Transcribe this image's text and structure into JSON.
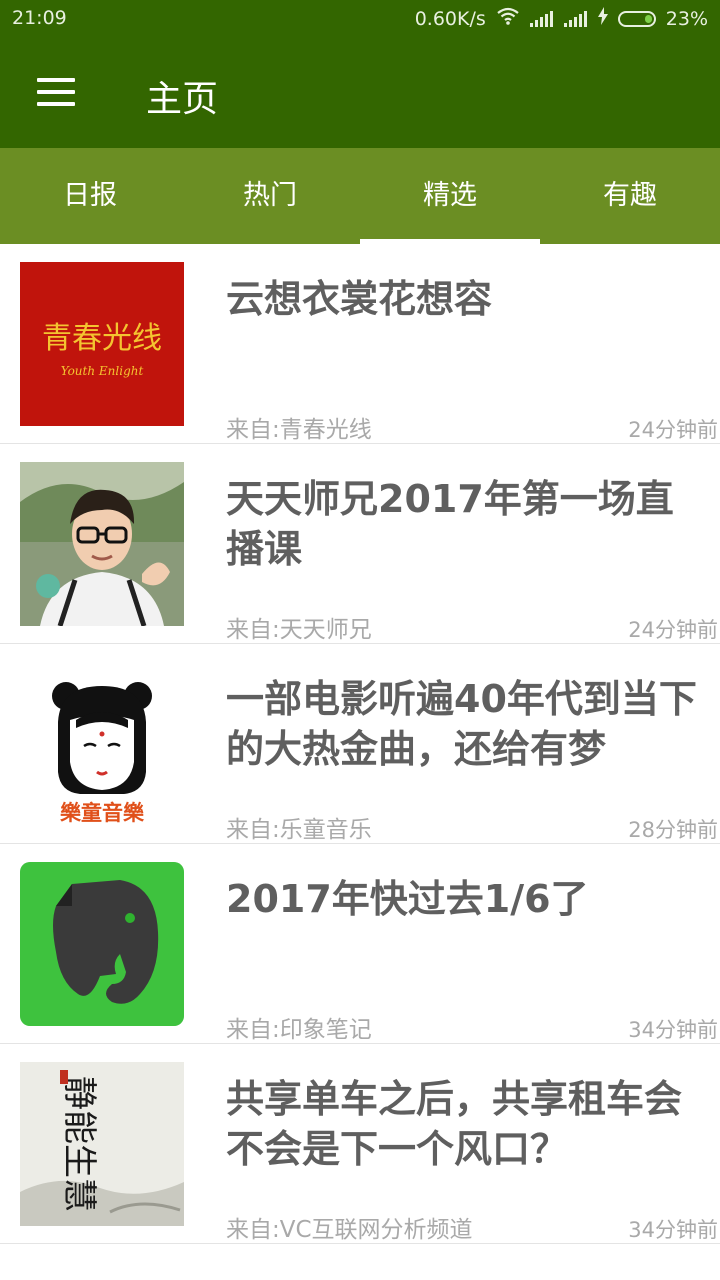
{
  "status": {
    "time": "21:09",
    "speed": "0.60K/s",
    "battery": "23%",
    "battery_level": 0.23,
    "icons": [
      "wifi-icon",
      "signal-icon",
      "signal-icon",
      "charging-icon",
      "battery-icon"
    ]
  },
  "toolbar": {
    "title": "主页",
    "menu_icon": "hamburger-menu-icon"
  },
  "tabs": [
    {
      "label": "日报"
    },
    {
      "label": "热门"
    },
    {
      "label": "精选",
      "active": true
    },
    {
      "label": "有趣"
    }
  ],
  "articles": [
    {
      "title": "云想衣裳花想容",
      "source": "来自:青春光线",
      "time": "24分钟前",
      "thumb_text": "青春光线",
      "thumb_subtext": "Youth Enlight"
    },
    {
      "title": "天天师兄2017年第一场直播课",
      "source": "来自:天天师兄",
      "time": "24分钟前"
    },
    {
      "title": "一部电影听遍40年代到当下的大热金曲，还给有梦",
      "source": "来自:乐童音乐",
      "time": "28分钟前",
      "thumb_text": "樂童音樂"
    },
    {
      "title": "2017年快过去1/6了",
      "source": "来自:印象笔记",
      "time": "34分钟前"
    },
    {
      "title": "共享单车之后，共享租车会不会是下一个风口？",
      "source": "来自:VC互联网分析频道",
      "time": "34分钟前",
      "thumb_text": "静能生慧"
    }
  ],
  "colors": {
    "toolbar": "#336600",
    "tabs": "#6b8e23",
    "headline": "#5f5f5f",
    "meta": "#a9a9a9"
  }
}
